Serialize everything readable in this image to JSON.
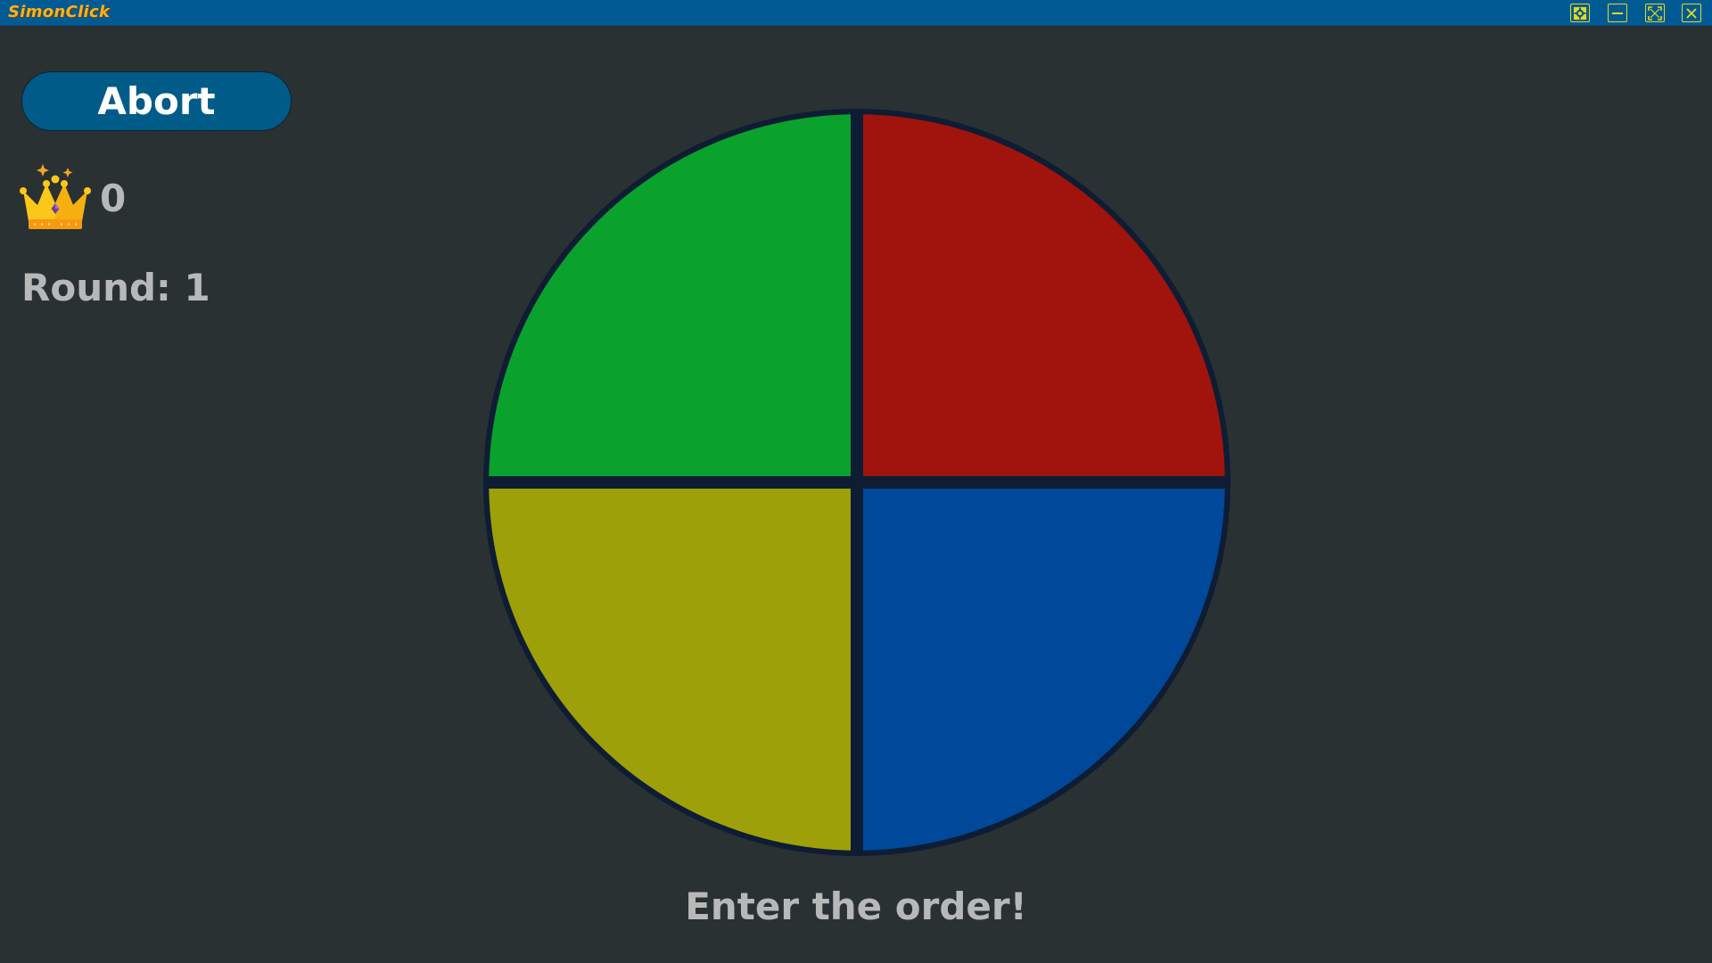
{
  "window": {
    "title": "SimonClick",
    "controls": [
      "settings-icon",
      "minimize-icon",
      "maximize-icon",
      "close-icon"
    ]
  },
  "game": {
    "abort_label": "Abort",
    "high_score": "0",
    "round_label": "Round:",
    "round_value": "1",
    "prompt": "Enter the order!"
  },
  "board": {
    "quadrants": [
      {
        "name": "green",
        "color": "#0ba12d"
      },
      {
        "name": "red",
        "color": "#a0140d"
      },
      {
        "name": "yellow",
        "color": "#9ea00a"
      },
      {
        "name": "blue",
        "color": "#00489a"
      }
    ],
    "outline_color": "#0e1d33"
  },
  "colors": {
    "background": "#293133",
    "titlebar": "#005b94",
    "title_text": "#f5b321",
    "window_controls": "#e8d81c",
    "abort_button": "#005b88",
    "text": "#b7b9b8"
  }
}
